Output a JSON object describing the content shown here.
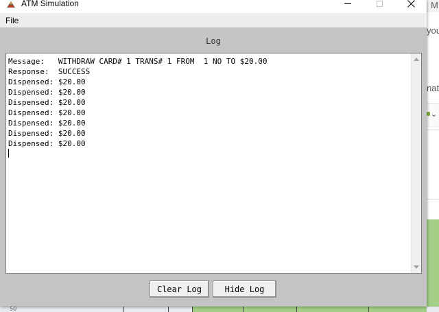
{
  "window": {
    "title": "ATM Simulation",
    "controls": {
      "minimize": "minimize",
      "maximize": "maximize",
      "close": "✕"
    }
  },
  "menu": {
    "items": [
      {
        "label": "File"
      }
    ]
  },
  "log": {
    "title": "Log",
    "lines": [
      "Message:   WITHDRAW CARD# 1 TRANS# 1 FROM  1 NO TO $20.00",
      "Response:  SUCCESS",
      "Dispensed: $20.00",
      "Dispensed: $20.00",
      "Dispensed: $20.00",
      "Dispensed: $20.00",
      "Dispensed: $20.00",
      "Dispensed: $20.00",
      "Dispensed: $20.00"
    ]
  },
  "buttons": {
    "clear_log": "Clear Log",
    "hide_log": "Hide Log"
  },
  "background": {
    "text_m": "M",
    "text_you": "you",
    "text_nat": "nat",
    "row_number": "50"
  },
  "colors": {
    "window_bg": "#c4c4c4",
    "green_cells": "#a3cf86"
  }
}
